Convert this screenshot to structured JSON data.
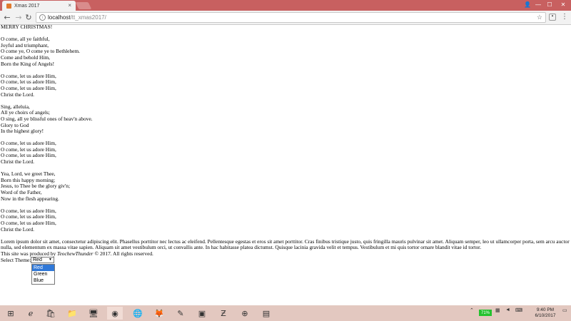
{
  "browser": {
    "tab_title": "Xmas 2017",
    "url_host": "localhost",
    "url_path": "/tt_xmas2017/"
  },
  "page": {
    "heading": "MERRY CHRISTMAS!",
    "stanzas": [
      [
        "O come, all ye faithful,",
        "Joyful and triumphant,",
        "O come ye, O come ye to Bethlehem.",
        "Come and behold Him,",
        "Born the King of Angels!"
      ],
      [
        "O come, let us adore Him,",
        "O come, let us adore Him,",
        "O come, let us adore Him,",
        "Christ the Lord."
      ],
      [
        "Sing, alleluia,",
        "All ye choirs of angels;",
        "O sing, all ye blissful ones of heav'n above.",
        "Glory to God",
        "In the highest glory!"
      ],
      [
        "O come, let us adore Him,",
        "O come, let us adore Him,",
        "O come, let us adore Him,",
        "Christ the Lord."
      ],
      [
        "Yea, Lord, we greet Thee,",
        "Born this happy morning;",
        "Jesus, to Thee be the glory giv'n;",
        "Word of the Father,",
        "Now in the flesh appearing."
      ],
      [
        "O come, let us adore Him,",
        "O come, let us adore Him,",
        "O come, let us adore Him,",
        "Christ the Lord."
      ]
    ],
    "lorem": "Lorem ipsum dolor sit amet, consectetur adipiscing elit. Phasellus porttitor nec lectus ac eleifend. Pellentesque egestas et eros sit amet porttitor. Cras finibus tristique justo, quis fringilla mauris pulvinar sit amet. Aliquam semper, leo ut ullamcorper porta, sem arcu auctor nulla, sed elementum ex massa vitae sapien. Aliquam sit amet vestibulum orci, ut convallis ante. In hac habitasse platea dictumst. Quisque lacinia gravida velit et tempus. Vestibulum et mi quis tortor ornare blandit vitae id tortor.",
    "credit_prefix": "This site was produced by ",
    "credit_author": "TeochewThunder",
    "credit_suffix": " © 2017. All rights reserved.",
    "theme_label": "Select Theme:",
    "theme_selected": "Red",
    "theme_options": [
      "Red",
      "Green",
      "Blue"
    ]
  },
  "taskbar": {
    "battery": "71%",
    "time": "9:40 PM",
    "date": "6/10/2017"
  },
  "colors": {
    "titlebar": "#c86060",
    "selected_option": "#3078d8",
    "taskbar": "#e3c8c0"
  }
}
